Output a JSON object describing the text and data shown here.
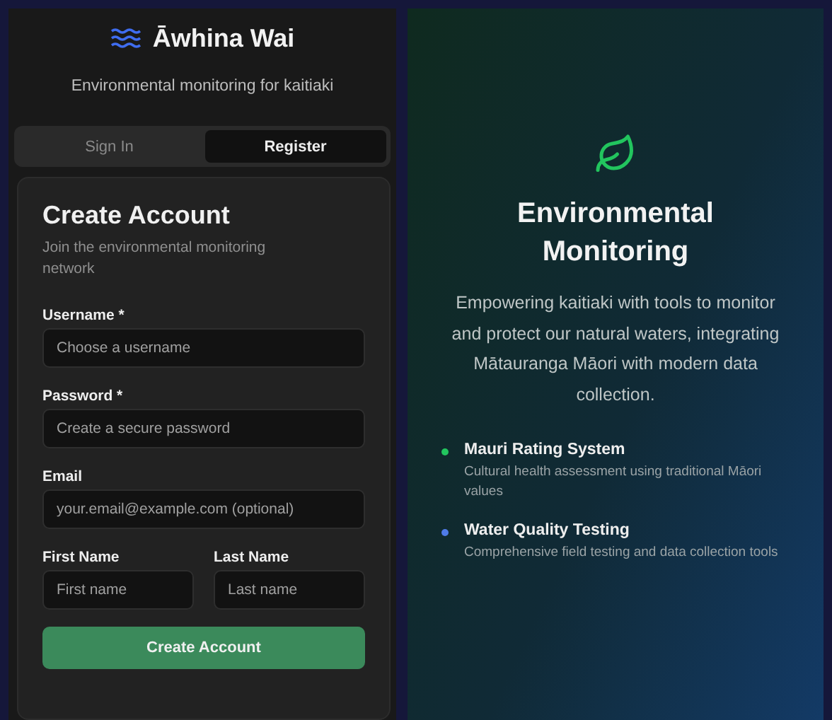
{
  "brand": {
    "title": "Āwhina Wai",
    "subtitle": "Environmental monitoring for kaitiaki"
  },
  "tabs": [
    {
      "label": "Sign In",
      "selected": false
    },
    {
      "label": "Register",
      "selected": true
    }
  ],
  "form": {
    "title": "Create Account",
    "description": "Join the environmental monitoring network",
    "fields": [
      {
        "label": "Username *",
        "placeholder": "Choose a username"
      },
      {
        "label": "Password *",
        "placeholder": "Create a secure password"
      },
      {
        "label": "Email",
        "placeholder": "your.email@example.com (optional)"
      }
    ],
    "name_fields": [
      {
        "label": "First Name",
        "placeholder": "First name"
      },
      {
        "label": "Last Name",
        "placeholder": "Last name"
      }
    ],
    "submit": "Create Account"
  },
  "hero": {
    "title": "Environmental Monitoring",
    "text": "Empowering kaitiaki with tools to monitor and protect our natural waters, integrating Mātauranga Māori with modern data collection.",
    "features": [
      {
        "title": "Mauri Rating System",
        "description": "Cultural health assessment using traditional Māori values",
        "color": "#22c55e"
      },
      {
        "title": "Water Quality Testing",
        "description": "Comprehensive field testing and data collection tools",
        "color": "#4f7be8"
      }
    ]
  }
}
